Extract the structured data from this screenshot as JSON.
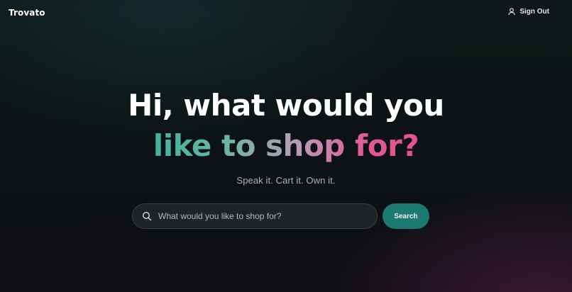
{
  "header": {
    "logo": "Trovato",
    "sign_out_label": "Sign Out"
  },
  "hero": {
    "headline_line1": "Hi, what would you",
    "headline_line2": "like to shop for?",
    "tagline": "Speak it. Cart it. Own it."
  },
  "search": {
    "placeholder": "What would you like to shop for?",
    "value": "",
    "button_label": "Search",
    "icon": "search-icon"
  },
  "colors": {
    "accent_teal": "#1c7a70",
    "gradient_start": "#3fb59b",
    "gradient_end": "#e8508f"
  }
}
